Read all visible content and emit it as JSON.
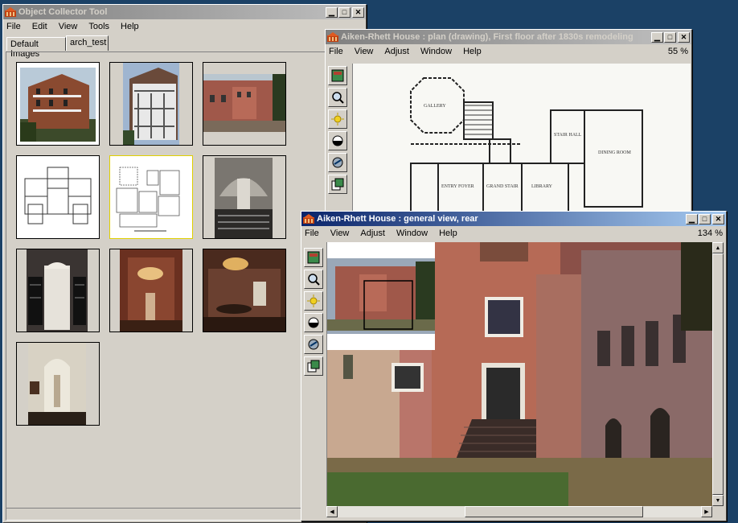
{
  "desktop": {
    "color": "#1b4166"
  },
  "collector": {
    "title": "Object Collector Tool",
    "menu": [
      "File",
      "Edit",
      "View",
      "Tools",
      "Help"
    ],
    "tabs": [
      {
        "label": "Default Images"
      },
      {
        "label": "arch_test"
      }
    ],
    "thumbnails": [
      {
        "icon": "house-exterior-photo"
      },
      {
        "icon": "porch-house-photo"
      },
      {
        "icon": "courtyard-photo"
      },
      {
        "icon": "floor-plan-drawing"
      },
      {
        "icon": "floor-plan-drawing-selected"
      },
      {
        "icon": "stair-hall-photo"
      },
      {
        "icon": "ironwork-stair-photo"
      },
      {
        "icon": "chandelier-room-photo"
      },
      {
        "icon": "dining-room-photo"
      },
      {
        "icon": "niche-statue-photo"
      }
    ]
  },
  "plan_window": {
    "title": "Aiken-Rhett House : plan (drawing), First floor after 1830s remodeling",
    "menu": [
      "File",
      "View",
      "Adjust",
      "Window",
      "Help"
    ],
    "zoom": "55 %",
    "rooms": [
      "GALLERY",
      "STAIR HALL",
      "DINING ROOM",
      "ENTRY FOYER",
      "GRAND STAIR",
      "LIBRARY"
    ]
  },
  "view_window": {
    "title": "Aiken-Rhett House : general view, rear",
    "menu": [
      "File",
      "View",
      "Adjust",
      "Window",
      "Help"
    ],
    "zoom": "134 %"
  },
  "tools": [
    "navigator-icon",
    "zoom-icon",
    "brightness-icon",
    "contrast-icon",
    "link-icon",
    "export-icon"
  ]
}
